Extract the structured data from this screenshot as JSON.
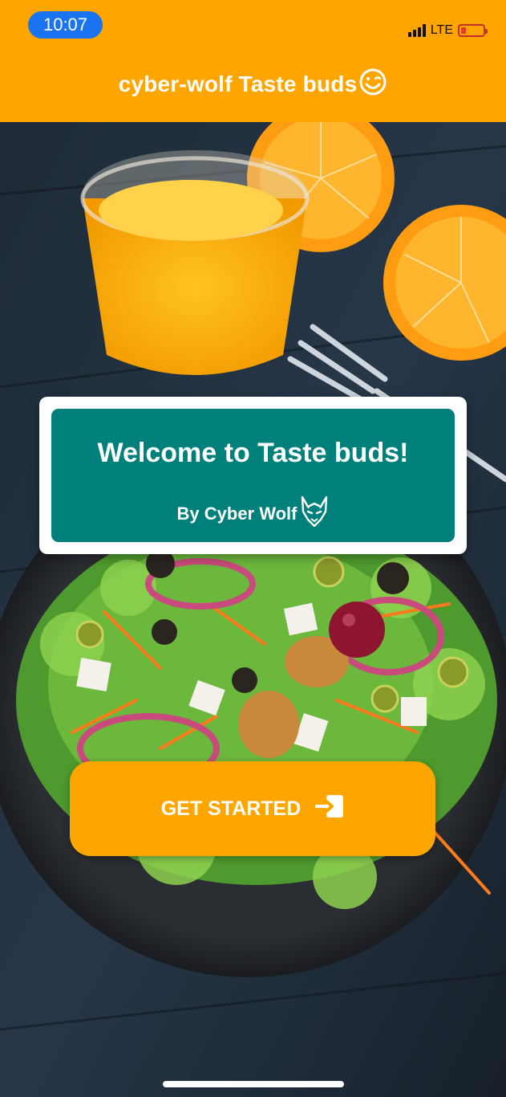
{
  "status_bar": {
    "time": "10:07",
    "network": "LTE",
    "battery_level": 0.15,
    "colors": {
      "time_pill": "#1a73f0",
      "battery": "#e5392e"
    }
  },
  "app_bar": {
    "title": "cyber-wolf Taste buds",
    "title_icon": "smiley-wink-icon",
    "background": "#ffa500"
  },
  "welcome": {
    "title": "Welcome to Taste buds!",
    "byline": "By Cyber Wolf",
    "byline_icon": "wolf-logo-icon",
    "background": "#00807a"
  },
  "actions": {
    "get_started_label": "GET STARTED",
    "get_started_icon": "login-arrow-icon",
    "background": "#ffa500"
  },
  "background_image": "photo of orange juice glass, orange halves, fork and salad plate on dark table"
}
